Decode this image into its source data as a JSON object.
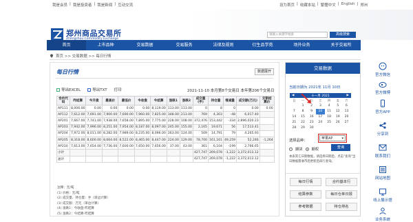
{
  "topbar": {
    "left_links": [
      "我是会员",
      "我是投资者",
      "我是新闻",
      "互动交流"
    ],
    "right_links": [
      "设为首页",
      "收藏本站",
      "繁體中文",
      "English",
      "郑州"
    ]
  },
  "header": {
    "logo_cn": "郑州商品交易所",
    "logo_en": "Zhengzhou Commodity Exchange",
    "search_placeholder": "请输入关键字搜索",
    "search_button": "高级搜索"
  },
  "nav": [
    "首页",
    "上市品种",
    "交易数据",
    "交易服务",
    "法律及规则",
    "衍生品学苑",
    "场外业务",
    "关于交易所"
  ],
  "breadcrumb": "首页 >> 交易数据 >> 每日行情",
  "main": {
    "title": "每日行情",
    "data_button": "数据展开",
    "export_excel": "导出EXCEL",
    "export_txt": "导出TXT",
    "print": "打印",
    "date_line": "2021-11-10  本月第8个交易日  本年第206个交易日",
    "columns": [
      "合约代码",
      "昨结算",
      "今开盘",
      "最高价",
      "最低价",
      "今收盘",
      "今结算",
      "涨跌1",
      "涨跌2",
      "成交量(手)",
      "持仓量",
      "增减量",
      "成交额(万元)",
      "交割结算价"
    ],
    "rows": [
      [
        "AP111",
        "8,006.00",
        "0.00",
        "0.00",
        "0.00",
        "0.00",
        "8,119.00",
        "113.00",
        "113.00",
        "0",
        "8",
        "0",
        "0.00",
        "0.00"
      ],
      [
        "AP112",
        "7,612.00",
        "7,691.00",
        "7,900.00",
        "7,690.00",
        "7,960.00",
        "7,825.00",
        "348.00",
        "213.00",
        "769",
        "4,303",
        "-48",
        "6,017.40",
        ""
      ],
      [
        "AP201",
        "7,667.00",
        "7,741.00",
        "7,938.00",
        "7,658.00",
        "7,895.00",
        "7,775.00",
        "228.00",
        "108.00",
        "372,476",
        "153,442",
        "-334",
        "2,896,020.23",
        ""
      ],
      [
        "AP203",
        "7,942.00",
        "7,996.00",
        "8,251.00",
        "7,954.00",
        "8,187.00",
        "8,097.00",
        "245.00",
        "155.00",
        "2,165",
        "19,671",
        "56",
        "17,513.41",
        ""
      ],
      [
        "AP204",
        "7,972.00",
        "8,011.00",
        "8,282.00",
        "7,989.00",
        "8,235.00",
        "8,096.00",
        "263.00",
        "124.00",
        "509",
        "14,791",
        "79",
        "4,265.93",
        ""
      ],
      [
        "AP205",
        "8,318.00",
        "8,600.00",
        "8,664.00",
        "8,522.00",
        "8,465.00",
        "8,447.00",
        "224.00",
        "129.00",
        "78,700",
        "161,161",
        "49,259",
        "52,246",
        "-1,264"
      ],
      [
        "AP210",
        "7,613.00",
        "7,654.00",
        "7,736.00",
        "7,600.00",
        "7,650.00",
        "7,656.00",
        "37.00",
        "43.00",
        "361",
        "6,104",
        "-199",
        "2,766.65",
        ""
      ],
      [
        "小计",
        "",
        "",
        "",
        "",
        "",
        "",
        "",
        "",
        "427,747",
        "269,078",
        "-1,222",
        "3,372,013.12",
        ""
      ],
      [
        "总计",
        "",
        "",
        "",
        "",
        "",
        "",
        "",
        "",
        "427,747",
        "269,078",
        "-1,222",
        "3,372,013.12",
        ""
      ]
    ],
    "notes": [
      "注释：元/吨",
      "(1) 价格：元/吨",
      "(2) 成交量、持仓量：手（单边计算）",
      "(3) 成交额：万元（单边计算）",
      "(4) 涨跌1：今收盘-昨结算",
      "(5) 涨跌2：今结算-昨结算"
    ]
  },
  "side": {
    "header": "交易数据",
    "date_label": "当前日期为 2021年 11月 10日",
    "calendar": {
      "month_label": "十一月 2021",
      "weekdays": [
        "日",
        "一",
        "二",
        "三",
        "四",
        "五",
        "六"
      ],
      "days": [
        "",
        "1",
        "2",
        "3",
        "4",
        "5",
        "6",
        "7",
        "8",
        "9",
        "10",
        "11",
        "12",
        "13",
        "14",
        "15",
        "16",
        "17",
        "18",
        "19",
        "20",
        "21",
        "22",
        "23",
        "24",
        "25",
        "26",
        "27",
        "28",
        "29",
        "30",
        "",
        "",
        "",
        ""
      ],
      "selected": "10"
    },
    "select_label": "选择品种：",
    "select_value": "苹果AP",
    "radio_futures": "期货",
    "radio_options": "期权",
    "query_button": "查询",
    "note": "本表其它日期数据，请选择日期后，点击\"查询\"当日数据需收市后更新后再行查询。",
    "buttons": [
      "每日行情",
      "合约基本行",
      "结算参数",
      "每日仓单日报",
      "参考数据",
      "持仓排名"
    ]
  },
  "rail": [
    "官方微信",
    "官方微博",
    "官方APP",
    "分享到",
    "联系我们",
    "网站地图",
    "线上展示馆",
    "业务系统"
  ]
}
